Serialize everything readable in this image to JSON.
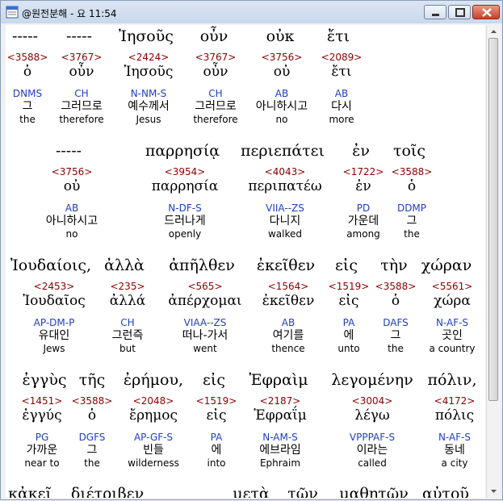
{
  "window": {
    "title": "@원전분해 - 요 11:54"
  },
  "icons": {
    "app": "app-icon",
    "minimize": "minimize-icon",
    "maximize": "maximize-icon",
    "close": "close-icon"
  },
  "lines": [
    {
      "greek": [
        "-----",
        "-----",
        "Ἰησοῦς",
        "οὖν",
        "οὐκ",
        "ἔτι"
      ],
      "words": [
        {
          "num": "<3588>",
          "lex": "ὁ",
          "parse": "DNMS",
          "kor": "그",
          "eng": "the"
        },
        {
          "num": "<3767>",
          "lex": "οὖν",
          "parse": "CH",
          "kor": "그러므로",
          "eng": "therefore"
        },
        {
          "num": "<2424>",
          "lex": "Ἰησοῦς",
          "parse": "N-NM-S",
          "kor": "예수께서",
          "eng": "Jesus"
        },
        {
          "num": "<3767>",
          "lex": "οὖν",
          "parse": "CH",
          "kor": "그러므로",
          "eng": "therefore"
        },
        {
          "num": "<3756>",
          "lex": "οὐ",
          "parse": "AB",
          "kor": "아니하시고",
          "eng": "no"
        },
        {
          "num": "<2089>",
          "lex": "ἔτι",
          "parse": "AB",
          "kor": "다시",
          "eng": "more"
        }
      ]
    },
    {
      "greek": [
        "-----",
        "παρρησίᾳ",
        "περιεπάτει",
        "ἐν",
        "τοῖς"
      ],
      "words": [
        {
          "num": "<3756>",
          "lex": "οὐ",
          "parse": "AB",
          "kor": "아니하시고",
          "eng": "no"
        },
        {
          "num": "<3954>",
          "lex": "παρρησία",
          "parse": "N-DF-S",
          "kor": "드러나게",
          "eng": "openly"
        },
        {
          "num": "<4043>",
          "lex": "περιπατέω",
          "parse": "VIIA--ZS",
          "kor": "다니지",
          "eng": "walked"
        },
        {
          "num": "<1722>",
          "lex": "ἐν",
          "parse": "PD",
          "kor": "가운데",
          "eng": "among"
        },
        {
          "num": "<3588>",
          "lex": "ὁ",
          "parse": "DDMP",
          "kor": "그",
          "eng": "the"
        }
      ]
    },
    {
      "greek": [
        "Ἰουδαίοις,",
        "ἀλλὰ",
        "ἀπῆλθεν",
        "ἐκεῖθεν",
        "εἰς",
        "τὴν",
        "χώραν"
      ],
      "words": [
        {
          "num": "<2453>",
          "lex": "Ἰουδαῖος",
          "parse": "AP-DM-P",
          "kor": "유대인",
          "eng": "Jews"
        },
        {
          "num": "<235>",
          "lex": "ἀλλά",
          "parse": "CH",
          "kor": "그런즉",
          "eng": "but"
        },
        {
          "num": "<565>",
          "lex": "ἀπέρχομαι",
          "parse": "VIAA--ZS",
          "kor": "떠나-가서",
          "eng": "went"
        },
        {
          "num": "<1564>",
          "lex": "ἐκεῖθεν",
          "parse": "AB",
          "kor": "여기를",
          "eng": "thence"
        },
        {
          "num": "<1519>",
          "lex": "εἰς",
          "parse": "PA",
          "kor": "에",
          "eng": "unto"
        },
        {
          "num": "<3588>",
          "lex": "ὁ",
          "parse": "DAFS",
          "kor": "그",
          "eng": "the"
        },
        {
          "num": "<5561>",
          "lex": "χώρα",
          "parse": "N-AF-S",
          "kor": "곳인",
          "eng": "a country"
        }
      ]
    },
    {
      "greek": [
        "ἐγγὺς",
        "τῆς",
        "ἐρήμου,",
        "εἰς",
        "Ἐφραὶμ",
        "λεγομένην",
        "πόλιν,"
      ],
      "words": [
        {
          "num": "<1451>",
          "lex": "ἐγγύς",
          "parse": "PG",
          "kor": "가까운",
          "eng": "near to"
        },
        {
          "num": "<3588>",
          "lex": "ὁ",
          "parse": "DGFS",
          "kor": "그",
          "eng": "the"
        },
        {
          "num": "<2048>",
          "lex": "ἔρημος",
          "parse": "AP-GF-S",
          "kor": "빈들",
          "eng": "wilderness"
        },
        {
          "num": "<1519>",
          "lex": "εἰς",
          "parse": "PA",
          "kor": "에",
          "eng": "into"
        },
        {
          "num": "<2187>",
          "lex": "Ἐφραΐμ",
          "parse": "N-AM-S",
          "kor": "에브라임",
          "eng": "Ephraim"
        },
        {
          "num": "<3004>",
          "lex": "λέγω",
          "parse": "VPPPAF-S",
          "kor": "이라는",
          "eng": "called"
        },
        {
          "num": "<4172>",
          "lex": "πόλις",
          "parse": "N-AF-S",
          "kor": "동네",
          "eng": "a city"
        }
      ]
    },
    {
      "greek": [
        "κἀκεῖ",
        "διέτριβεν",
        "μετὰ",
        "τῶν",
        "μαθητῶν",
        "αὐτοῦ"
      ]
    }
  ]
}
